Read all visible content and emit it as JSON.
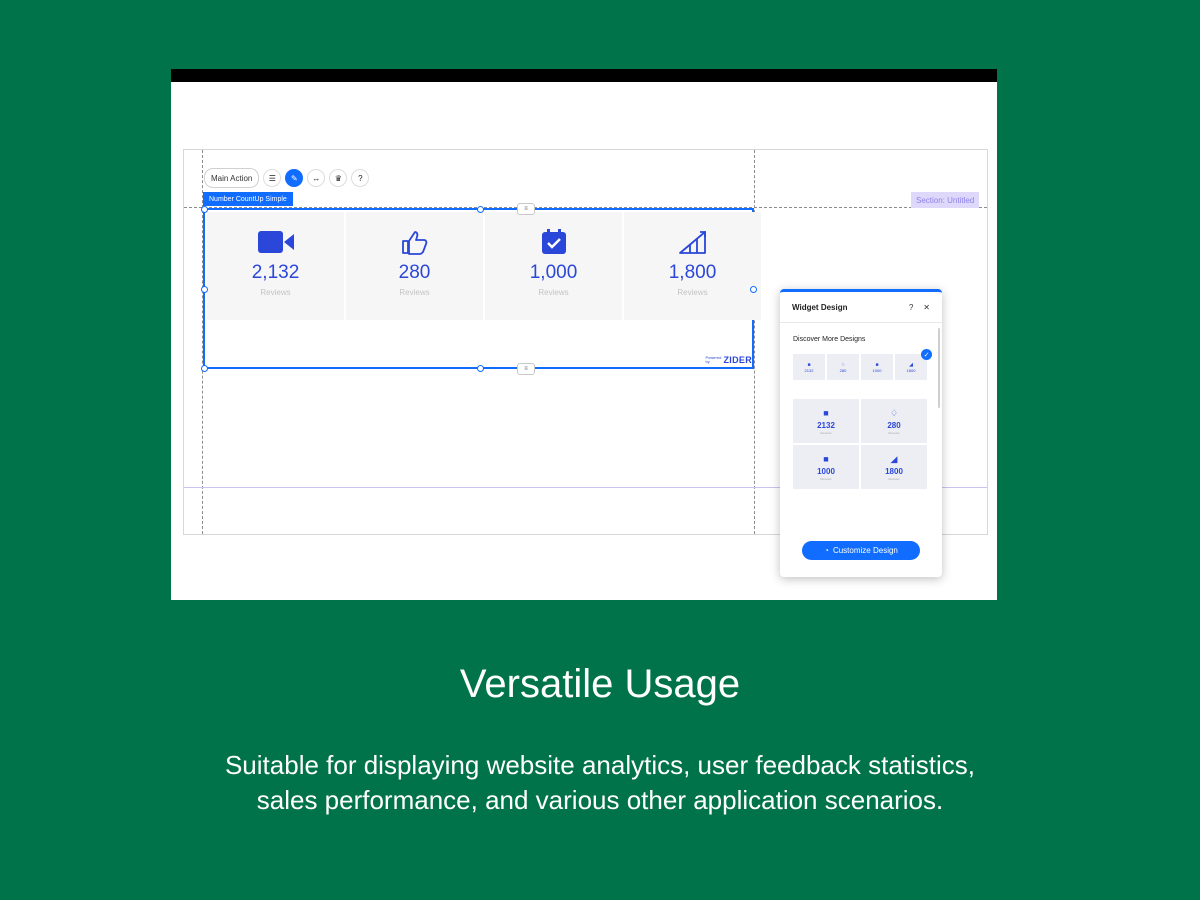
{
  "toolbar": {
    "main_action": "Main Action",
    "icons": [
      "list-settings-icon",
      "pen-icon",
      "stretch-icon",
      "crown-icon",
      "help-icon"
    ]
  },
  "widget": {
    "tag": "Number CountUp Simple",
    "section_tag": "Section: Untitled",
    "stats": [
      {
        "icon": "video-camera-icon",
        "value": "2,132",
        "label": "Reviews"
      },
      {
        "icon": "thumbs-up-icon",
        "value": "280",
        "label": "Reviews"
      },
      {
        "icon": "calendar-check-icon",
        "value": "1,000",
        "label": "Reviews"
      },
      {
        "icon": "growth-chart-icon",
        "value": "1,800",
        "label": "Reviews"
      }
    ],
    "powered_by": "Powered by",
    "brand": "ZIDER"
  },
  "panel": {
    "title": "Widget Design",
    "help": "?",
    "close": "✕",
    "subtitle": "Discover More Designs",
    "strip": [
      "2132",
      "280",
      "1000",
      "1800"
    ],
    "grid": [
      {
        "value": "2132",
        "label": "Reviews"
      },
      {
        "value": "280",
        "label": "Reviews"
      },
      {
        "value": "1000",
        "label": "Reviews"
      },
      {
        "value": "1800",
        "label": "Reviews"
      }
    ],
    "customize": "Customize Design"
  },
  "caption": {
    "title": "Versatile Usage",
    "line1": "Suitable for displaying website analytics, user feedback statistics,",
    "line2": "sales performance, and various other application scenarios."
  },
  "colors": {
    "background": "#00734a",
    "accent": "#116dff",
    "stat_text": "#2a47d9"
  }
}
